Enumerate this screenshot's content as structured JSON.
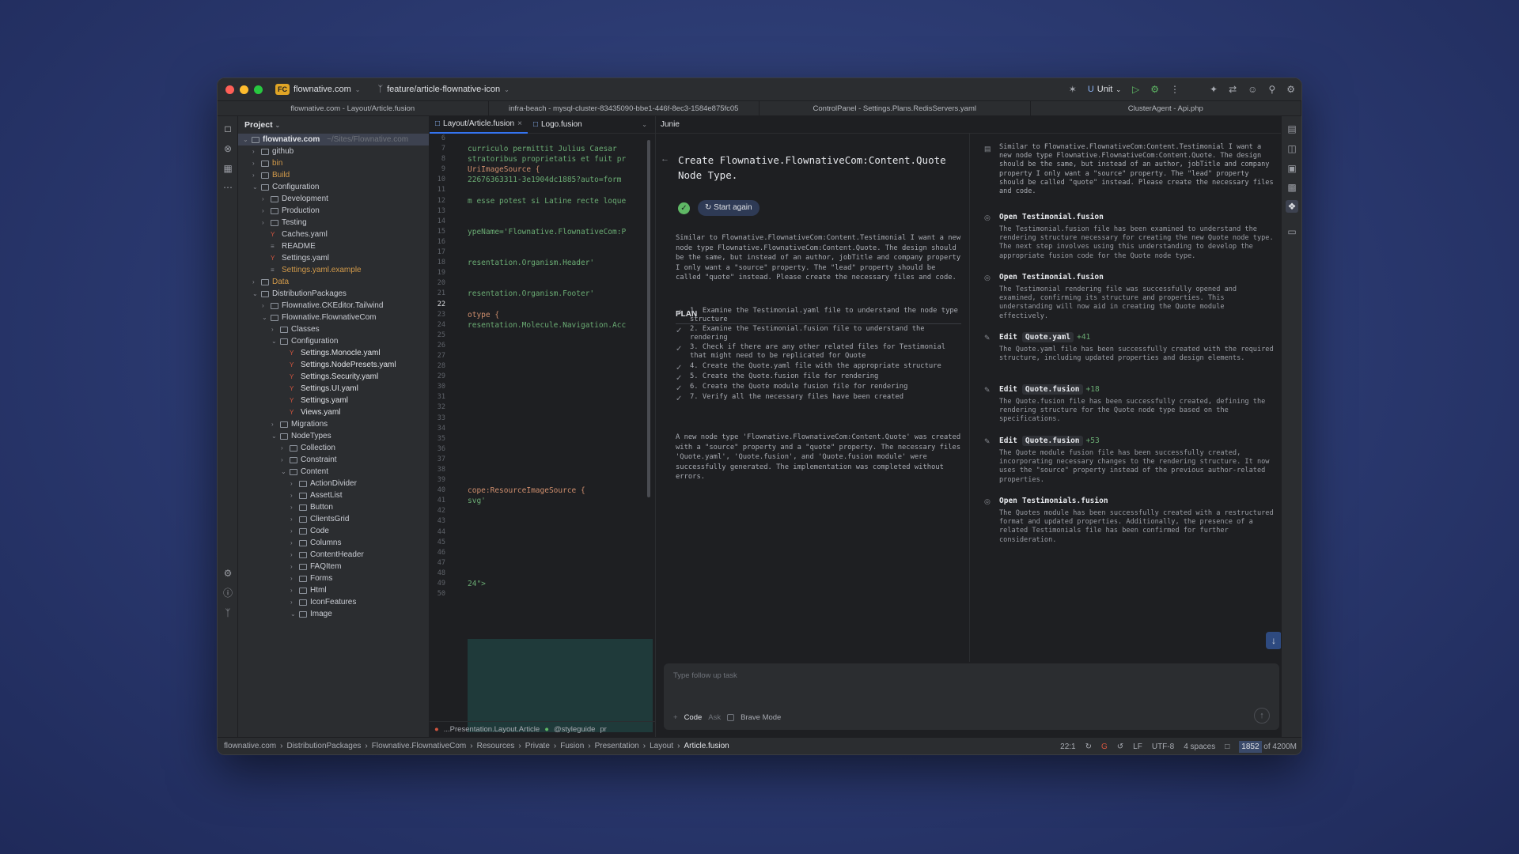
{
  "titlebar": {
    "project_badge": "FC",
    "project_name": "flownative.com",
    "branch": "feature/article-flownative-icon",
    "run_config": "Unit"
  },
  "project_tabs": [
    "flownative.com - Layout/Article.fusion",
    "infra-beach - mysql-cluster-83435090-bbe1-446f-8ec3-1584e875fc05",
    "ControlPanel - Settings.Plans.RedisServers.yaml",
    "ClusterAgent - Api.php"
  ],
  "project_panel": {
    "title": "Project",
    "root": "flownative.com",
    "root_path": "~/Sites/Flownative.com",
    "items": [
      {
        "label": "github",
        "depth": 1,
        "type": "folder",
        "arrow": ">"
      },
      {
        "label": "bin",
        "depth": 1,
        "type": "folder",
        "arrow": ">",
        "style": "orange"
      },
      {
        "label": "Build",
        "depth": 1,
        "type": "folder",
        "arrow": ">",
        "style": "orange"
      },
      {
        "label": "Configuration",
        "depth": 1,
        "type": "folder",
        "arrow": "v"
      },
      {
        "label": "Development",
        "depth": 2,
        "type": "folder",
        "arrow": ">"
      },
      {
        "label": "Production",
        "depth": 2,
        "type": "folder",
        "arrow": ">"
      },
      {
        "label": "Testing",
        "depth": 2,
        "type": "folder",
        "arrow": ">"
      },
      {
        "label": "Caches.yaml",
        "depth": 2,
        "type": "yaml"
      },
      {
        "label": "README",
        "depth": 2,
        "type": "text"
      },
      {
        "label": "Settings.yaml",
        "depth": 2,
        "type": "yaml"
      },
      {
        "label": "Settings.yaml.example",
        "depth": 2,
        "type": "text",
        "style": "orange"
      },
      {
        "label": "Data",
        "depth": 1,
        "type": "folder",
        "arrow": ">",
        "style": "orange"
      },
      {
        "label": "DistributionPackages",
        "depth": 1,
        "type": "folder",
        "arrow": "v"
      },
      {
        "label": "Flownative.CKEditor.Tailwind",
        "depth": 2,
        "type": "folder",
        "arrow": ">"
      },
      {
        "label": "Flownative.FlownativeCom",
        "depth": 2,
        "type": "folder",
        "arrow": "v"
      },
      {
        "label": "Classes",
        "depth": 3,
        "type": "folder",
        "arrow": ">"
      },
      {
        "label": "Configuration",
        "depth": 3,
        "type": "folder",
        "arrow": "v"
      },
      {
        "label": "Settings.Monocle.yaml",
        "depth": 4,
        "type": "yaml"
      },
      {
        "label": "Settings.NodePresets.yaml",
        "depth": 4,
        "type": "yaml"
      },
      {
        "label": "Settings.Security.yaml",
        "depth": 4,
        "type": "yaml"
      },
      {
        "label": "Settings.UI.yaml",
        "depth": 4,
        "type": "yaml"
      },
      {
        "label": "Settings.yaml",
        "depth": 4,
        "type": "yaml"
      },
      {
        "label": "Views.yaml",
        "depth": 4,
        "type": "yaml"
      },
      {
        "label": "Migrations",
        "depth": 3,
        "type": "folder",
        "arrow": ">"
      },
      {
        "label": "NodeTypes",
        "depth": 3,
        "type": "folder",
        "arrow": "v"
      },
      {
        "label": "Collection",
        "depth": 4,
        "type": "folder",
        "arrow": ">"
      },
      {
        "label": "Constraint",
        "depth": 4,
        "type": "folder",
        "arrow": ">"
      },
      {
        "label": "Content",
        "depth": 4,
        "type": "folder",
        "arrow": "v"
      },
      {
        "label": "ActionDivider",
        "depth": 5,
        "type": "folder",
        "arrow": ">"
      },
      {
        "label": "AssetList",
        "depth": 5,
        "type": "folder",
        "arrow": ">"
      },
      {
        "label": "Button",
        "depth": 5,
        "type": "folder",
        "arrow": ">"
      },
      {
        "label": "ClientsGrid",
        "depth": 5,
        "type": "folder",
        "arrow": ">"
      },
      {
        "label": "Code",
        "depth": 5,
        "type": "folder",
        "arrow": ">"
      },
      {
        "label": "Columns",
        "depth": 5,
        "type": "folder",
        "arrow": ">"
      },
      {
        "label": "ContentHeader",
        "depth": 5,
        "type": "folder",
        "arrow": ">"
      },
      {
        "label": "FAQItem",
        "depth": 5,
        "type": "folder",
        "arrow": ">"
      },
      {
        "label": "Forms",
        "depth": 5,
        "type": "folder",
        "arrow": ">"
      },
      {
        "label": "Html",
        "depth": 5,
        "type": "folder",
        "arrow": ">"
      },
      {
        "label": "IconFeatures",
        "depth": 5,
        "type": "folder",
        "arrow": ">"
      },
      {
        "label": "Image",
        "depth": 5,
        "type": "folder",
        "arrow": "v"
      }
    ]
  },
  "editor": {
    "tabs": [
      "Layout/Article.fusion",
      "Logo.fusion"
    ],
    "line_numbers": [
      "6",
      "7",
      "8",
      "9",
      "10",
      "11",
      "12",
      "13",
      "14",
      "15",
      "16",
      "17",
      "18",
      "19",
      "20",
      "21",
      "22",
      "23",
      "24",
      "25",
      "26",
      "27",
      "28",
      "29",
      "30",
      "31",
      "32",
      "33",
      "34",
      "35",
      "36",
      "37",
      "38",
      "39",
      "40",
      "41",
      "42",
      "43",
      "44",
      "45",
      "46",
      "47",
      "48",
      "49",
      "50"
    ],
    "lines": [
      {
        "text": "",
        "cls": ""
      },
      {
        "text": " curriculo permittit Julius Caesar",
        "cls": "c-green"
      },
      {
        "text": "stratoribus proprietatis et fuit pr",
        "cls": "c-green"
      },
      {
        "text": "UriImageSource {",
        "cls": "c-orange"
      },
      {
        "text": "22676363311-3e1904dc1885?auto=form",
        "cls": "c-green"
      },
      {
        "text": "",
        "cls": ""
      },
      {
        "text": "m esse potest si Latine recte loque",
        "cls": "c-green"
      },
      {
        "text": "",
        "cls": ""
      },
      {
        "text": "",
        "cls": ""
      },
      {
        "text": "ypeName='Flownative.FlownativeCom:P",
        "cls": "c-green"
      },
      {
        "text": "",
        "cls": ""
      },
      {
        "text": "",
        "cls": ""
      },
      {
        "text": "resentation.Organism.Header'",
        "cls": "c-green"
      },
      {
        "text": "",
        "cls": ""
      },
      {
        "text": "",
        "cls": ""
      },
      {
        "text": "resentation.Organism.Footer'",
        "cls": "c-green"
      },
      {
        "text": "",
        "cls": ""
      },
      {
        "text": "otype {",
        "cls": "c-orange"
      },
      {
        "text": "resentation.Molecule.Navigation.Acc",
        "cls": "c-green"
      },
      {
        "text": "",
        "cls": ""
      },
      {
        "text": "",
        "cls": ""
      },
      {
        "text": "",
        "cls": ""
      },
      {
        "text": "",
        "cls": ""
      },
      {
        "text": "",
        "cls": ""
      },
      {
        "text": "",
        "cls": ""
      },
      {
        "text": "",
        "cls": ""
      },
      {
        "text": "",
        "cls": ""
      },
      {
        "text": "",
        "cls": ""
      },
      {
        "text": "",
        "cls": ""
      },
      {
        "text": "",
        "cls": ""
      },
      {
        "text": "",
        "cls": ""
      },
      {
        "text": "",
        "cls": ""
      },
      {
        "text": "",
        "cls": ""
      },
      {
        "text": "",
        "cls": ""
      },
      {
        "text": "cope:ResourceImageSource {",
        "cls": "c-orange"
      },
      {
        "text": "svg'",
        "cls": "c-green"
      },
      {
        "text": "",
        "cls": ""
      },
      {
        "text": "",
        "cls": ""
      },
      {
        "text": "",
        "cls": ""
      },
      {
        "text": "",
        "cls": ""
      },
      {
        "text": "",
        "cls": ""
      },
      {
        "text": "",
        "cls": ""
      },
      {
        "text": "",
        "cls": ""
      },
      {
        "text": "24\">",
        "cls": "c-green"
      },
      {
        "text": "",
        "cls": ""
      }
    ],
    "footer": [
      "...Presentation.Layout.Article",
      "@styleguide",
      "pr"
    ]
  },
  "junie": {
    "title": "Junie",
    "task_title": "Create Flownative.FlownativeCom:Content.Quote Node Type.",
    "start_again": "Start again",
    "description": "Similar to Flownative.FlownativeCom:Content.Testimonial I want a new node type Flownative.FlownativeCom:Content.Quote. The design should be the same, but instead of an author, jobTitle and company property I only want a \"source\" property. The \"lead\" property should be called \"quote\" instead. Please create the necessary files and code.",
    "plan_label": "PLAN",
    "plan": [
      "1. Examine the Testimonial.yaml file to understand the node type structure",
      "2. Examine the Testimonial.fusion file to understand the rendering",
      "3. Check if there are any other related files for Testimonial that might need to be replicated for Quote",
      "4. Create the Quote.yaml file with the appropriate structure",
      "5. Create the Quote.fusion file for rendering",
      "6. Create the Quote module fusion file for rendering",
      "7. Verify all the necessary files have been created"
    ],
    "summary": "A new node type 'Flownative.FlownativeCom:Content.Quote' was created with a \"source\" property and a \"quote\" property. The necessary files 'Quote.yaml', 'Quote.fusion', and 'Quote.fusion module' were successfully generated. The implementation was completed without errors.",
    "log_intro": "Similar to Flownative.FlownativeCom:Content.Testimonial I want a new node type Flownative.FlownativeCom:Content.Quote. The design should be the same, but instead of an author, jobTitle and company property I only want a \"source\" property. The \"lead\" property should be called \"quote\" instead. Please create the necessary files and code.",
    "log": [
      {
        "action": "Open",
        "file": "Testimonial.fusion",
        "plus": "",
        "text": "The Testimonial.fusion file has been examined to understand the rendering structure necessary for creating the new Quote node type. The next step involves using this understanding to develop the appropriate fusion code for the Quote node type."
      },
      {
        "action": "Open",
        "file": "Testimonial.fusion",
        "plus": "",
        "text": "The Testimonial rendering file was successfully opened and examined, confirming its structure and properties. This understanding will now aid in creating the Quote module effectively."
      },
      {
        "action": "Edit",
        "file": "Quote.yaml",
        "plus": "+41",
        "text": "The Quote.yaml file has been successfully created with the required structure, including updated properties and design elements."
      },
      {
        "action": "Edit",
        "file": "Quote.fusion",
        "plus": "+18",
        "text": "The Quote.fusion file has been successfully created, defining the rendering structure for the Quote node type based on the specifications."
      },
      {
        "action": "Edit",
        "file": "Quote.fusion",
        "plus": "+53",
        "text": "The Quote module fusion file has been successfully created, incorporating necessary changes to the rendering structure. It now uses the \"source\" property instead of the previous author-related properties."
      },
      {
        "action": "Open",
        "file": "Testimonials.fusion",
        "plus": "",
        "text": "The Quotes module has been successfully created with a restructured format and updated properties. Additionally, the presence of a related Testimonials file has been confirmed for further consideration."
      }
    ],
    "input_placeholder": "Type follow up task",
    "mode_code": "Code",
    "mode_ask": "Ask",
    "brave_mode": "Brave Mode"
  },
  "statusbar": {
    "crumbs": [
      "flownative.com",
      "DistributionPackages",
      "Flownative.FlownativeCom",
      "Resources",
      "Private",
      "Fusion",
      "Presentation",
      "Layout",
      "Article.fusion"
    ],
    "position": "22:1",
    "line_ending": "LF",
    "encoding": "UTF-8",
    "indent": "4 spaces",
    "memory_used": "1852",
    "memory_total": "of 4200M"
  },
  "colors": {
    "background": "#2c3b72",
    "window": "#1e1f22",
    "panel": "#2b2d30",
    "accent": "#3574f0",
    "check_green": "#5fb865"
  }
}
